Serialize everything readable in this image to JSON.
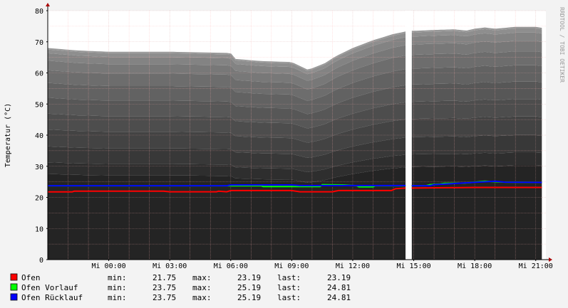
{
  "chart_data": {
    "type": "area",
    "ylabel": "Temperatur (°C)",
    "watermark": "RRDTOOL / TOBI OETIKER",
    "ylim": [
      0,
      80
    ],
    "y_ticks": [
      "0",
      "10",
      "20",
      "30",
      "40",
      "50",
      "60",
      "70",
      "80"
    ],
    "x_range_hours": [
      -3,
      21.5
    ],
    "x_ticks": [
      {
        "label": "Mi 00:00",
        "hour": 0
      },
      {
        "label": "Mi 03:00",
        "hour": 3
      },
      {
        "label": "Mi 06:00",
        "hour": 6
      },
      {
        "label": "Mi 09:00",
        "hour": 9
      },
      {
        "label": "Mi 12:00",
        "hour": 12
      },
      {
        "label": "Mi 15:00",
        "hour": 15
      },
      {
        "label": "Mi 18:00",
        "hour": 18
      },
      {
        "label": "Mi 21:00",
        "hour": 21
      }
    ],
    "data_gap_hours": [
      14.6,
      14.9
    ],
    "colors": {
      "background": "#f3f3f3",
      "canvas": "#ffffff",
      "grid_minor": "#ffb0b0",
      "grid_major": "#d8a0a0",
      "axis": "#000000",
      "arrow": "#aa0000",
      "bands": [
        "#242424",
        "#2e2e2e",
        "#383838",
        "#434343",
        "#4d4d4d",
        "#575757",
        "#626262",
        "#6d6d6d",
        "#787878",
        "#838383",
        "#8e8e8e",
        "#999999"
      ]
    },
    "envelope": {
      "x": [
        -3,
        -1.5,
        0,
        1.5,
        3,
        4.5,
        6,
        6.2,
        7.5,
        9,
        9.8,
        10.6,
        11.2,
        12,
        13,
        14,
        14.6
      ],
      "y": [
        68,
        67.2,
        66.8,
        66.8,
        66.8,
        66.6,
        66.4,
        64.5,
        63.8,
        63.5,
        61,
        63,
        65.5,
        68,
        70.5,
        72.5,
        73.3
      ]
    },
    "envelope2": {
      "x": [
        14.9,
        16,
        17,
        17.6,
        18,
        18.5,
        19,
        20,
        21,
        21.3
      ],
      "y": [
        73.5,
        73.8,
        74,
        73.6,
        74.2,
        74.6,
        74.2,
        74.8,
        74.8,
        74.5
      ]
    },
    "series": [
      {
        "name": "Ofen",
        "color": "#ff0000",
        "x": [
          -3,
          -1.8,
          -1.7,
          0,
          2.7,
          3.0,
          5.3,
          5.4,
          5.8,
          6.0,
          9.0,
          9.4,
          11.0,
          11.3,
          13.9,
          14.1,
          14.6
        ],
        "y": [
          21.75,
          21.75,
          22.0,
          22.0,
          22.0,
          21.8,
          21.8,
          22.0,
          21.8,
          22.2,
          22.2,
          21.8,
          21.8,
          22.2,
          22.2,
          22.8,
          23.0
        ],
        "x2": [
          14.9,
          18.0,
          21.3
        ],
        "y2": [
          23.0,
          23.19,
          23.19
        ],
        "min": "21.75",
        "max": "23.19",
        "last": "23.19"
      },
      {
        "name": "Ofen Vorlauf",
        "color": "#00ff00",
        "x": [
          -3,
          7.5,
          7.6,
          10.4,
          10.5,
          11.5,
          12.2,
          12.3,
          13.0,
          13.1,
          14.6
        ],
        "y": [
          23.75,
          23.75,
          23.5,
          23.5,
          24.1,
          24.0,
          23.75,
          23.4,
          23.4,
          23.75,
          23.75
        ],
        "x2": [
          14.9,
          15.6,
          15.8,
          16.3,
          16.5,
          17.5,
          18.0,
          18.5,
          19.5,
          21.3
        ],
        "y2": [
          23.75,
          23.75,
          24.1,
          24.3,
          24.5,
          24.6,
          24.9,
          25.19,
          24.9,
          24.81
        ],
        "min": "23.75",
        "max": "25.19",
        "last": "24.81"
      },
      {
        "name": "Ofen Rücklauf",
        "color": "#0000ff",
        "x": [
          -3,
          5.8,
          6.0,
          9.0,
          9.4,
          14.6
        ],
        "y": [
          23.75,
          23.75,
          24.0,
          24.0,
          23.8,
          23.8
        ],
        "x2": [
          14.9,
          15.8,
          16.0,
          19.0,
          19.5,
          21.3
        ],
        "y2": [
          23.75,
          23.75,
          24.1,
          25.19,
          24.9,
          24.81
        ],
        "min": "23.75",
        "max": "25.19",
        "last": "24.81"
      }
    ],
    "legend": {
      "min_label": "min:",
      "max_label": "max:",
      "last_label": "last:"
    }
  }
}
